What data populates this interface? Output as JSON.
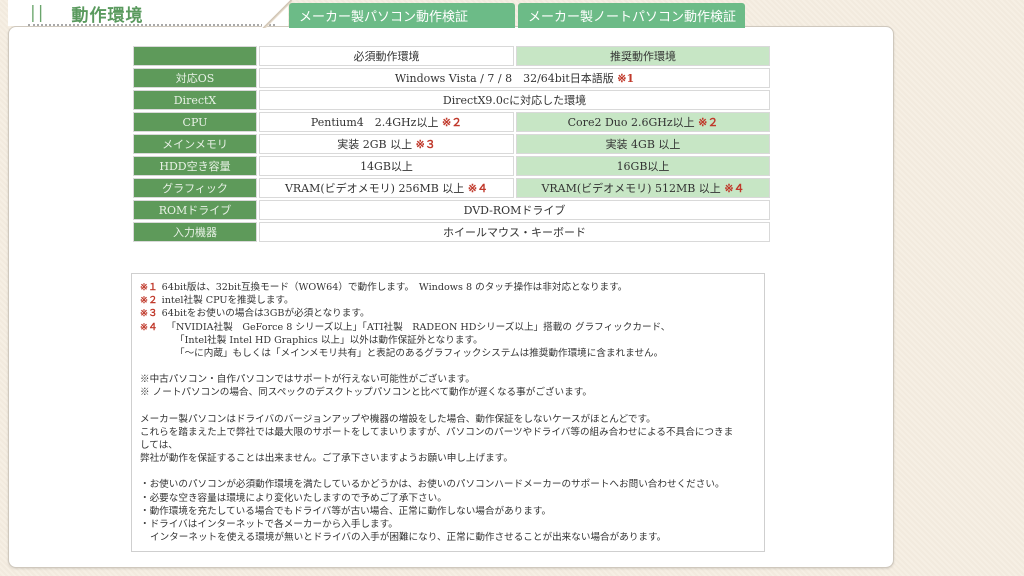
{
  "header": {
    "title_bars": "||",
    "title": "動作環境"
  },
  "tabs": [
    {
      "label": "メーカー製パソコン動作検証"
    },
    {
      "label": "メーカー製ノートパソコン動作検証"
    }
  ],
  "spec_table": {
    "col_required": "必須動作環境",
    "col_recommended": "推奨動作環境",
    "rows": [
      {
        "label": "対応OS",
        "both": "Windows Vista / 7 / 8　32/64bit日本語版",
        "both_note": "※1"
      },
      {
        "label": "DirectX",
        "both": "DirectX9.0cに対応した環境",
        "both_note": ""
      },
      {
        "label": "CPU",
        "required": "Pentium4　2.4GHz以上",
        "required_note": "※２",
        "recommended": "Core2 Duo 2.6GHz以上",
        "recommended_note": "※２"
      },
      {
        "label": "メインメモリ",
        "required": "実装 2GB 以上",
        "required_note": "※３",
        "recommended": "実装 4GB 以上",
        "recommended_note": ""
      },
      {
        "label": "HDD空き容量",
        "required": "14GB以上",
        "required_note": "",
        "recommended": "16GB以上",
        "recommended_note": ""
      },
      {
        "label": "グラフィック",
        "required": "VRAM(ビデオメモリ) 256MB 以上",
        "required_note": "※４",
        "recommended": "VRAM(ビデオメモリ) 512MB 以上",
        "recommended_note": "※４"
      },
      {
        "label": "ROMドライブ",
        "both": "DVD-ROMドライブ",
        "both_note": ""
      },
      {
        "label": "入力機器",
        "both": "ホイールマウス・キーボード",
        "both_note": ""
      }
    ]
  },
  "notes": {
    "footnotes": [
      {
        "mark": "※１",
        "text": "64bit版は、32bit互換モード（WOW64）で動作します。　Windows 8 のタッチ操作は非対応となります。"
      },
      {
        "mark": "※２",
        "text": "intel社製 CPUを推奨します。"
      },
      {
        "mark": "※３",
        "text": "64bitをお使いの場合は3GBが必須となります。"
      },
      {
        "mark": "※４",
        "text": "　「NVIDIA社製　GeForce 8 シリーズ以上」「ATI社製　RADEON HDシリーズ以上」搭載の グラフィックカード、"
      }
    ],
    "footnote4_cont": [
      "「Intel社製 Intel HD Graphics 以上」以外は動作保証外となります。",
      "「～に内蔵」もしくは「メインメモリ共有」と表記のあるグラフィックシステムは推奨動作環境に含まれません。"
    ],
    "pc_notes": [
      "※中古パソコン・自作パソコンではサポートが行えない可能性がございます。",
      "※ ノートパソコンの場合、同スペックのデスクトップパソコンと比べて動作が遅くなる事がございます。"
    ],
    "maker_notes": [
      "メーカー製パソコンはドライバのバージョンアップや機器の増設をした場合、動作保証をしないケースがほとんどです。",
      "これらを踏まえた上で弊社では最大限のサポートをしてまいりますが、パソコンのパーツやドライバ等の組み合わせによる不具合につきま",
      "しては、",
      "弊社が動作を保証することは出来ません。ご了承下さいますようお願い申し上げます。"
    ],
    "bullets": [
      "・お使いのパソコンが必須動作環境を満たしているかどうかは、お使いのパソコンハードメーカーのサポートへお問い合わせください。",
      "・必要な空き容量は環境により変化いたしますので予めご了承下さい。",
      "・動作環境を充たしている場合でもドライバ等が古い場合、正常に動作しない場合があります。",
      "・ドライバはインターネットで各メーカーから入手します。"
    ],
    "bullet_cont": "インターネットを使える環境が無いとドライバの入手が困難になり、正常に動作させることが出来ない場合があります。"
  }
}
